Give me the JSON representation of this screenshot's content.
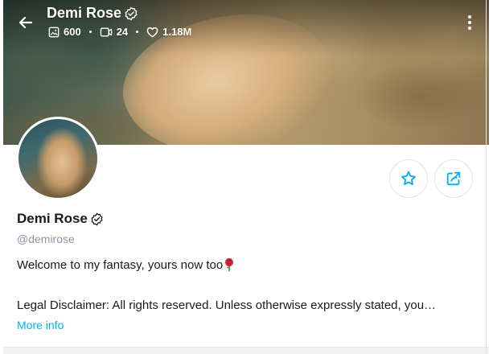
{
  "header": {
    "name": "Demi Rose",
    "stats": {
      "photos": "600",
      "videos": "24",
      "likes": "1.18M"
    }
  },
  "profile": {
    "name": "Demi Rose",
    "handle": "@demirose",
    "bio_line1": "Welcome to my fantasy, yours now too",
    "bio_line2": "Legal Disclaimer: All rights reserved. Unless otherwise expressly stated, you…",
    "more_info": "More info"
  },
  "icons": {
    "back": "arrow-left-icon",
    "verified": "verified-badge-icon",
    "photo": "image-icon",
    "video": "video-icon",
    "like": "heart-icon",
    "more": "more-vertical-icon",
    "favorite": "star-icon",
    "share": "share-icon",
    "emoji": "rose-emoji"
  },
  "colors": {
    "accent": "#00aff0",
    "handle": "#8a96a3"
  }
}
